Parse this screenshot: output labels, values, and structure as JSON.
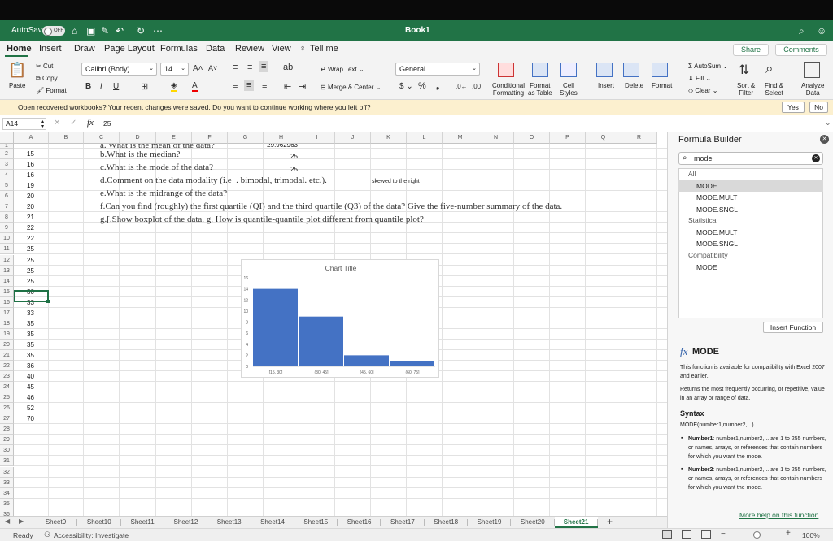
{
  "titlebar": {
    "autosave_label": "AutoSave",
    "autosave_state": "OFF",
    "title": "Book1"
  },
  "ribbon_tabs": [
    "Home",
    "Insert",
    "Draw",
    "Page Layout",
    "Formulas",
    "Data",
    "Review",
    "View",
    "Tell me"
  ],
  "share_label": "Share",
  "comments_label": "Comments",
  "clipboard": {
    "paste": "Paste",
    "cut": "Cut",
    "copy": "Copy",
    "format": "Format"
  },
  "font": {
    "name": "Calibri (Body)",
    "size": "14"
  },
  "alignment": {
    "wrap_text": "Wrap Text",
    "merge_center": "Merge & Center"
  },
  "number": {
    "format": "General"
  },
  "styles": {
    "conditional": [
      "Conditional",
      "Formatting"
    ],
    "format_table": [
      "Format",
      "as Table"
    ],
    "cell_styles": [
      "Cell",
      "Styles"
    ]
  },
  "cells": {
    "insert": "Insert",
    "delete": "Delete",
    "format": "Format"
  },
  "editing": {
    "autosum": "AutoSum",
    "fill": "Fill",
    "clear": "Clear",
    "sort_filter": [
      "Sort &",
      "Filter"
    ],
    "find_select": [
      "Find &",
      "Select"
    ],
    "analyze": [
      "Analyze",
      "Data"
    ]
  },
  "notice": {
    "message": "Open recovered workbooks?  Your recent changes were saved. Do you want to continue working where you left off?",
    "yes": "Yes",
    "no": "No"
  },
  "formula_bar": {
    "name_box": "A14",
    "fx": "fx",
    "value": "25"
  },
  "columns": [
    "A",
    "B",
    "C",
    "D",
    "E",
    "F",
    "G",
    "H",
    "I",
    "J",
    "K",
    "L",
    "M",
    "N",
    "O",
    "P",
    "Q",
    "R"
  ],
  "rows": [
    "1",
    "2",
    "3",
    "4",
    "5",
    "6",
    "7",
    "8",
    "9",
    "10",
    "11",
    "12",
    "13",
    "14",
    "15",
    "16",
    "17",
    "18",
    "19",
    "20",
    "21",
    "22",
    "23",
    "24",
    "25",
    "26",
    "27",
    "28",
    "29",
    "30",
    "31",
    "32",
    "33",
    "34",
    "35",
    "36"
  ],
  "col_a_values": [
    "",
    "15",
    "16",
    "16",
    "19",
    "20",
    "20",
    "21",
    "22",
    "22",
    "25",
    "25",
    "25",
    "25",
    "30",
    "33",
    "33",
    "35",
    "35",
    "35",
    "35",
    "36",
    "40",
    "45",
    "46",
    "52",
    "70"
  ],
  "questions": {
    "q1_partial": "a. What is the mean of the data?",
    "q2": "b.What is the median?",
    "q3": "c.What is the mode of the data?",
    "q4": "d.Comment on the data modality (i.e_. bimodal, trimodal. etc.).",
    "q5": "e.What is the midrange of the data?",
    "q6": "f.Can you find (roughly) the first quartile (QI) and the third quartile (Q3) of the data? Give the five-number summary of the data.",
    "q7": "g.[.Show boxplot of the data. g. How is quantile-quantile plot different from quantile plot?"
  },
  "h_values": {
    "h1": "29.962963",
    "h2": "25",
    "h3": "25"
  },
  "k4_text": "skewed to the right",
  "chart_data": {
    "type": "bar",
    "title": "Chart Title",
    "categories": [
      "[15, 30]",
      "(30, 45]",
      "(45, 60]",
      "(60, 75]"
    ],
    "values": [
      14,
      9,
      2,
      1
    ],
    "ylim": [
      0,
      16
    ],
    "yticks": [
      "0",
      "2",
      "4",
      "6",
      "8",
      "10",
      "12",
      "14",
      "16"
    ],
    "bar_color": "#4472c4",
    "grid": false
  },
  "sheets": [
    "Sheet9",
    "Sheet10",
    "Sheet11",
    "Sheet12",
    "Sheet13",
    "Sheet14",
    "Sheet15",
    "Sheet16",
    "Sheet17",
    "Sheet18",
    "Sheet19",
    "Sheet20",
    "Sheet21"
  ],
  "active_sheet": "Sheet21",
  "status": {
    "ready": "Ready",
    "accessibility": "Accessibility: Investigate",
    "zoom": "100%"
  },
  "formula_builder": {
    "title": "Formula Builder",
    "search_value": "mode",
    "categories": [
      {
        "name": "All",
        "items": [
          "MODE",
          "MODE.MULT",
          "MODE.SNGL"
        ]
      },
      {
        "name": "Statistical",
        "items": [
          "MODE.MULT",
          "MODE.SNGL"
        ]
      },
      {
        "name": "Compatibility",
        "items": [
          "MODE"
        ]
      }
    ],
    "insert_button": "Insert Function",
    "fn_name": "MODE",
    "desc1": "This function is available for compatibility with Excel 2007 and earlier.",
    "desc2": "Returns the most frequently occurring, or repetitive, value in an array or range of data.",
    "syntax_heading": "Syntax",
    "syntax": "MODE(number1,number2,...)",
    "arg1_name": "Number1",
    "arg1_desc": ": number1,number2,... are 1 to 255 numbers, or names, arrays, or references that contain numbers for which you want the mode.",
    "arg2_name": "Number2",
    "arg2_desc": ": number1,number2,... are 1 to 255 numbers, or names, arrays, or references that contain numbers for which you want the mode.",
    "help_link": "More help on this function"
  },
  "colors": {
    "excel_green": "#217346",
    "selection": "#1e7145",
    "notice_bg": "#fcf0cf"
  }
}
